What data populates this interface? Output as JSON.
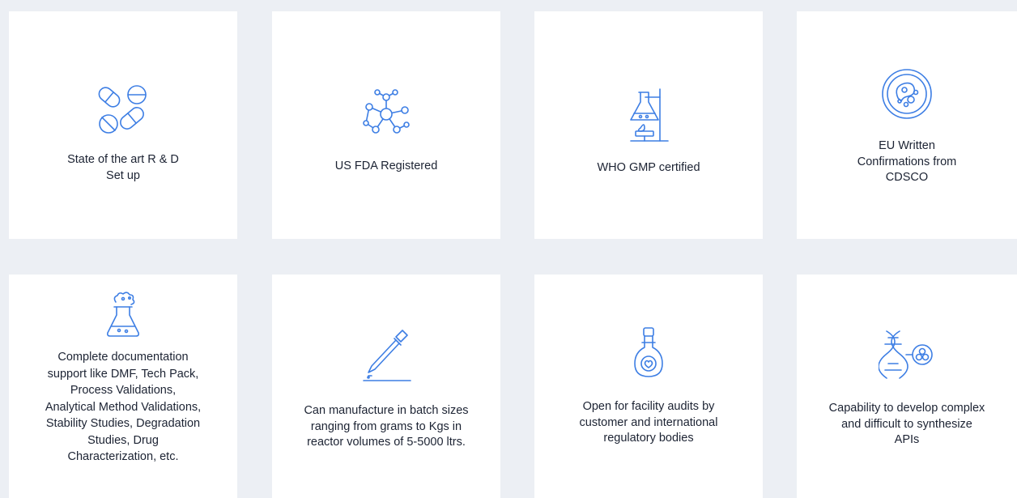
{
  "features": [
    {
      "icon": "pills-icon",
      "label": "State of the art R & D\nSet up"
    },
    {
      "icon": "molecule-icon",
      "label": "US FDA Registered"
    },
    {
      "icon": "lab-flask-stand-icon",
      "label": "WHO GMP certified"
    },
    {
      "icon": "petri-dish-icon",
      "label": "EU Written\nConfirmations from\nCDSCO"
    },
    {
      "icon": "erlenmeyer-flask-icon",
      "label": "Complete documentation\nsupport like DMF, Tech Pack,\nProcess Validations,\nAnalytical Method Validations,\nStability Studies, Degradation\nStudies, Drug\nCharacterization, etc."
    },
    {
      "icon": "pipette-icon",
      "label": "Can manufacture in batch sizes\nranging from grams to Kgs in\nreactor volumes of 5-5000 ltrs."
    },
    {
      "icon": "round-flask-icon",
      "label": "Open for facility audits by\ncustomer and international\nregulatory bodies"
    },
    {
      "icon": "dna-cell-icon",
      "label": "Capability to develop complex\nand difficult to synthesize\nAPIs"
    }
  ],
  "colors": {
    "background": "#eceff4",
    "card": "#ffffff",
    "icon": "#3d7ee4",
    "text": "#1c2333"
  }
}
